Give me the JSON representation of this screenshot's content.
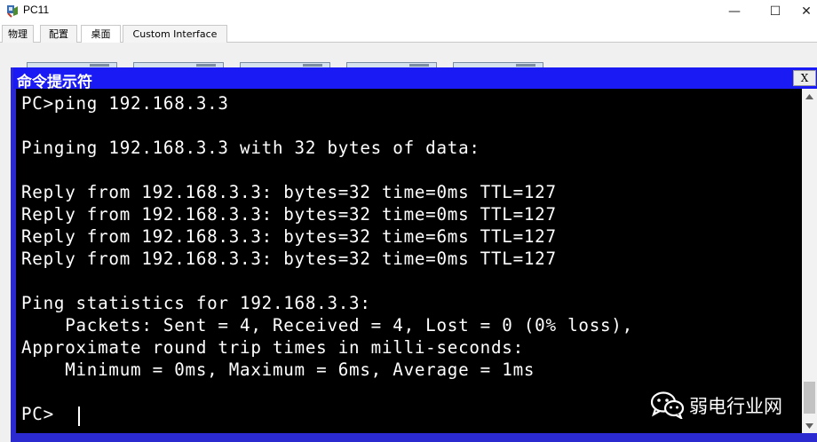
{
  "window": {
    "title": "PC11",
    "minimize_glyph": "—",
    "maximize_glyph": "☐",
    "close_glyph": "✕"
  },
  "tabs": [
    {
      "label": "物理",
      "active": false
    },
    {
      "label": "配置",
      "active": false
    },
    {
      "label": "桌面",
      "active": true
    },
    {
      "label": "Custom Interface",
      "active": false
    }
  ],
  "cmd": {
    "title": "命令提示符",
    "close_label": "X"
  },
  "terminal": {
    "lines": [
      "PC>ping 192.168.3.3",
      "",
      "Pinging 192.168.3.3 with 32 bytes of data:",
      "",
      "Reply from 192.168.3.3: bytes=32 time=0ms TTL=127",
      "Reply from 192.168.3.3: bytes=32 time=0ms TTL=127",
      "Reply from 192.168.3.3: bytes=32 time=6ms TTL=127",
      "Reply from 192.168.3.3: bytes=32 time=0ms TTL=127",
      "",
      "Ping statistics for 192.168.3.3:",
      "    Packets: Sent = 4, Received = 4, Lost = 0 (0% loss),",
      "Approximate round trip times in milli-seconds:",
      "    Minimum = 0ms, Maximum = 6ms, Average = 1ms",
      "",
      "PC>"
    ]
  },
  "watermark": {
    "text": "弱电行业网",
    "icon": "wechat-icon"
  },
  "colors": {
    "cmd_titlebar": "#1a1af5",
    "cmd_frame": "#2a2ad0",
    "terminal_bg": "#000000",
    "terminal_fg": "#ffffff"
  }
}
